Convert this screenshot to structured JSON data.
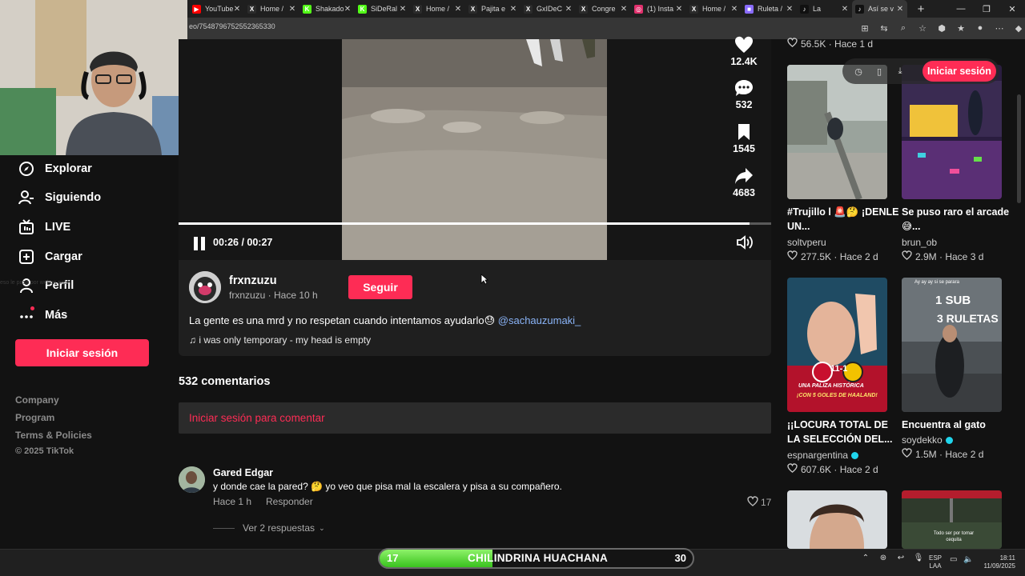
{
  "browser": {
    "tabs": [
      {
        "title": "YouTube",
        "color": "#ff0000",
        "glyph": "▶"
      },
      {
        "title": "Home /",
        "color": "#2b2b2b",
        "glyph": "X"
      },
      {
        "title": "Shakado",
        "color": "#53fc18",
        "glyph": "K"
      },
      {
        "title": "SiDeRal",
        "color": "#53fc18",
        "glyph": "K"
      },
      {
        "title": "Home /",
        "color": "#2b2b2b",
        "glyph": "X"
      },
      {
        "title": "Pajita e",
        "color": "#2b2b2b",
        "glyph": "X"
      },
      {
        "title": "GxIDeC",
        "color": "#2b2b2b",
        "glyph": "X"
      },
      {
        "title": "Congre",
        "color": "#2b2b2b",
        "glyph": "X"
      },
      {
        "title": "(1) Insta",
        "color": "#e1306c",
        "glyph": "◎"
      },
      {
        "title": "Home /",
        "color": "#2b2b2b",
        "glyph": "X"
      },
      {
        "title": "Ruleta /",
        "color": "#8a6cff",
        "glyph": "■"
      },
      {
        "title": "La",
        "color": "#111111",
        "glyph": "♪"
      },
      {
        "title": "Así se v",
        "color": "#111111",
        "glyph": "♪",
        "active": true
      }
    ],
    "url": "eo/7548796752552365330",
    "new_tab": "+",
    "window": {
      "minimize": "—",
      "maximize": "❐",
      "close": "✕"
    }
  },
  "sidebar": {
    "items": [
      {
        "label": "Explorar",
        "icon": "compass-icon"
      },
      {
        "label": "Siguiendo",
        "icon": "following-icon"
      },
      {
        "label": "LIVE",
        "icon": "live-icon"
      },
      {
        "label": "Cargar",
        "icon": "upload-icon"
      },
      {
        "label": "Perfil",
        "icon": "profile-icon"
      },
      {
        "label": "Más",
        "icon": "more-icon"
      }
    ],
    "login": "Iniciar sesión",
    "footer": [
      "Company",
      "Program",
      "Terms & Policies",
      "© 2025 TikTok"
    ]
  },
  "video": {
    "time": "00:26 / 00:27",
    "progress": 0.963,
    "actions": [
      {
        "icon": "heart-icon",
        "count": "12.4K"
      },
      {
        "icon": "comment-icon",
        "count": "532"
      },
      {
        "icon": "bookmark-icon",
        "count": "1545"
      },
      {
        "icon": "share-icon",
        "count": "4683"
      }
    ]
  },
  "post": {
    "username": "frxnzuzu",
    "meta": "frxnzuzu · Hace 10 h",
    "follow": "Seguir",
    "caption": "La gente es una mrd y no respetan cuando intentamos ayudarlo😓",
    "mention": "@sachauzumaki_",
    "music_icon": "♫",
    "music": "i was only temporary - my head is empty"
  },
  "comments": {
    "count_label": "532 comentarios",
    "login_prompt": "Iniciar sesión para comentar",
    "items": [
      {
        "user": "Gared Edgar",
        "text": "y donde cae la pared? 🤔 yo veo que pisa mal la escalera y pisa a su compañero.",
        "time": "Hace 1 h",
        "reply": "Responder",
        "likes": "17",
        "more": "Ver 2 respuestas"
      }
    ]
  },
  "right": {
    "top_stats": "56.5K · Hace 1 d",
    "overlay_login": "Iniciar sesión",
    "cards": [
      {
        "title": "#Trujillo l 🚨🤔 ¡DENLE UN...",
        "author": "soltvperu",
        "verified": false,
        "stats": "277.5K · Hace 2 d"
      },
      {
        "title": "Se puso raro el arcade 😅...",
        "author": "brun_ob",
        "verified": false,
        "stats": "2.9M · Hace 3 d"
      },
      {
        "title": "¡¡LOCURA TOTAL DE LA SELECCIÓN DEL...",
        "author": "espnargentina",
        "verified": true,
        "stats": "607.6K · Hace 2 d",
        "thumb_text": [
          "11-1",
          "UNA PALIZA HISTÓRICA",
          "¡CON 5 GOLES DE HAALAND!"
        ]
      },
      {
        "title": "Encuentra al gato",
        "author": "soydekko",
        "verified": true,
        "stats": "1.5M · Hace 2 d",
        "thumb_text": [
          "Ay ay ay si se parara",
          "1 SUB",
          "3 RULETAS"
        ]
      },
      {
        "title": "",
        "author": "",
        "verified": false,
        "stats": ""
      },
      {
        "title": "",
        "author": "",
        "verified": false,
        "stats": "",
        "thumb_text": [
          "Todo ser por tomar cequita"
        ]
      }
    ]
  },
  "overlay_text": "eso le pasa por webon pes",
  "taskbar": {
    "score_left": "17",
    "score_name": "CHILINDRINA HUACHANA",
    "score_right": "30",
    "score_fill": 0.36,
    "lang": [
      "ESP",
      "LAA"
    ],
    "time": "18:11",
    "date": "11/09/2025"
  }
}
